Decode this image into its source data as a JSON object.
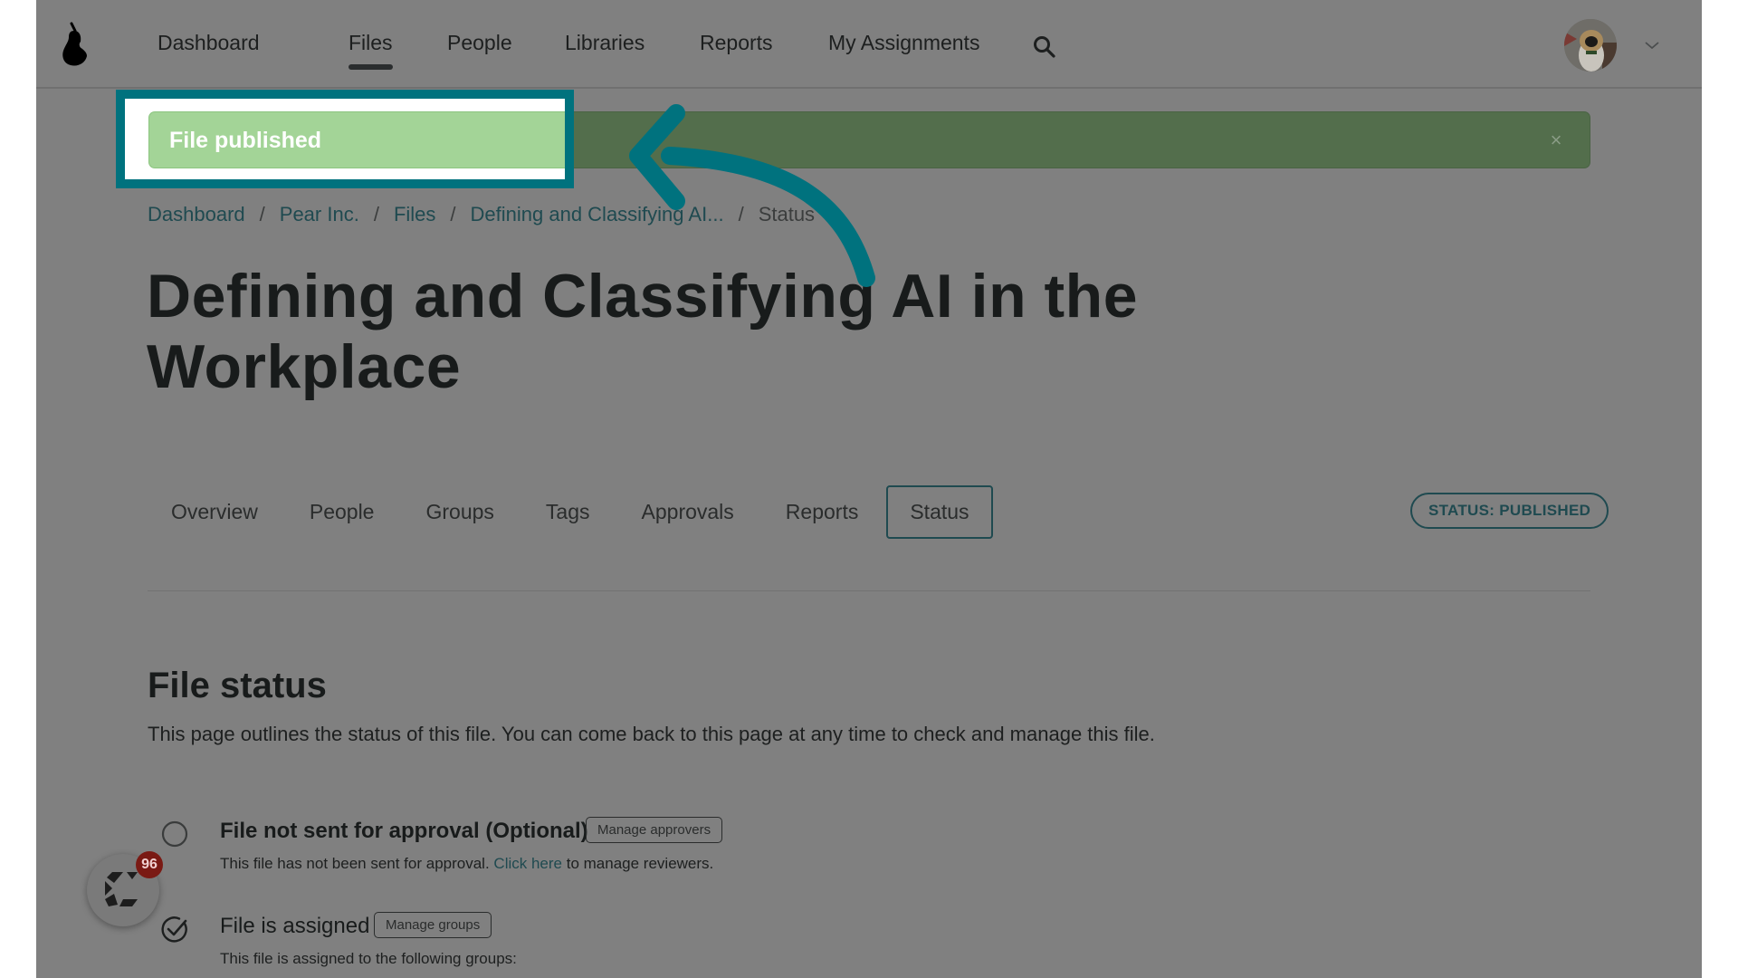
{
  "nav": {
    "logo": "pear-logo",
    "items": [
      {
        "label": "Dashboard",
        "active": false
      },
      {
        "label": "Files",
        "active": true
      },
      {
        "label": "People",
        "active": false
      },
      {
        "label": "Libraries",
        "active": false
      },
      {
        "label": "Reports",
        "active": false
      },
      {
        "label": "My Assignments",
        "active": false
      }
    ],
    "search_icon": "search-icon",
    "user_menu_icon": "chevron-down-icon"
  },
  "alert": {
    "message": "File published",
    "close_label": "×",
    "highlight_color": "#00727e"
  },
  "breadcrumb": {
    "items": [
      "Dashboard",
      "Pear Inc.",
      "Files",
      "Defining and Classifying AI..."
    ],
    "current": "Status",
    "separator": "/"
  },
  "page": {
    "title": "Defining and Classifying AI in the Workplace"
  },
  "tabs": {
    "items": [
      "Overview",
      "People",
      "Groups",
      "Tags",
      "Approvals",
      "Reports",
      "Status"
    ],
    "active": "Status"
  },
  "status_badge": "STATUS: PUBLISHED",
  "file_status": {
    "title": "File status",
    "description": "This page outlines the status of this file. You can come back to this page at any time to check and manage this file.",
    "items": [
      {
        "label": "File not sent for approval (Optional)",
        "state": "incomplete",
        "button": "Manage approvers",
        "sub_before": "This file has not been sent for approval.",
        "sub_link": "Click here",
        "sub_after": "to manage reviewers."
      },
      {
        "label": "File is assigned",
        "state": "complete",
        "button": "Manage groups",
        "sub_before": "This file is assigned to the following groups:"
      }
    ]
  },
  "widget": {
    "badge_count": "96"
  },
  "colors": {
    "accent": "#00727e",
    "success_bg": "#a3d497",
    "overlay": "#808080"
  }
}
